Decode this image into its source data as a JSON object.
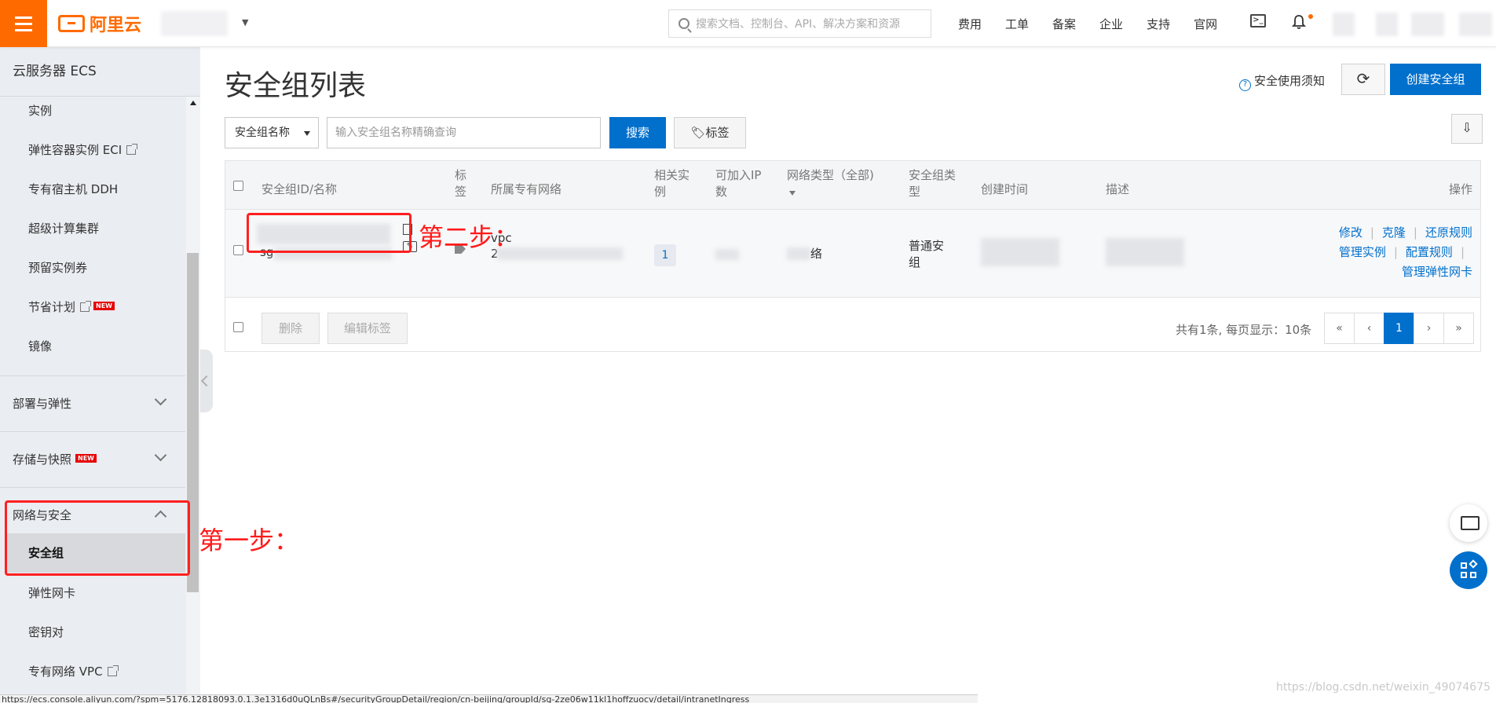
{
  "header": {
    "brand": "阿里云",
    "search_placeholder": "搜索文档、控制台、API、解决方案和资源",
    "nav": [
      "费用",
      "工单",
      "备案",
      "企业",
      "支持",
      "官网"
    ]
  },
  "sidebar": {
    "title": "云服务器 ECS",
    "items_top": [
      {
        "label": "实例"
      },
      {
        "label": "弹性容器实例 ECI",
        "external": true
      },
      {
        "label": "专有宿主机 DDH"
      },
      {
        "label": "超级计算集群"
      },
      {
        "label": "预留实例券"
      },
      {
        "label": "节省计划",
        "external": true,
        "badge": "NEW"
      },
      {
        "label": "镜像"
      }
    ],
    "groups": [
      {
        "label": "部署与弹性"
      },
      {
        "label": "存储与快照",
        "badge": "NEW"
      },
      {
        "label": "网络与安全",
        "expanded": true
      }
    ],
    "network_items": [
      {
        "label": "安全组",
        "active": true
      },
      {
        "label": "弹性网卡"
      },
      {
        "label": "密钥对"
      },
      {
        "label": "专有网络 VPC",
        "external": true
      }
    ]
  },
  "main": {
    "title": "安全组列表",
    "help_link": "安全使用须知",
    "refresh_glyph": "⟳",
    "create_button": "创建安全组",
    "filter_select": "安全组名称",
    "filter_placeholder": "输入安全组名称精确查询",
    "search_button": "搜索",
    "tag_button": "标签",
    "table": {
      "headers": {
        "id_name": "安全组ID/名称",
        "tag_l1": "标",
        "tag_l2": "签",
        "vpc": "所属专有网络",
        "instances_l1": "相关实",
        "instances_l2": "例",
        "ip_l1": "可加入IP",
        "ip_l2": "数",
        "net_type": "网络类型（全部)",
        "sg_type_l1": "安全组类",
        "sg_type_l2": "型",
        "created": "创建时间",
        "desc": "描述",
        "actions": "操作"
      },
      "row": {
        "id_prefix": "sg",
        "vpc_partial_1": "vpc",
        "vpc_partial_2": "2",
        "instances": "1",
        "net_type_suffix": "络",
        "sg_type_l1": "普通安",
        "sg_type_l2": "组",
        "actions": [
          "修改",
          "克隆",
          "还原规则",
          "管理实例",
          "配置规则",
          "管理弹性网卡"
        ]
      }
    },
    "footer": {
      "delete_button": "删除",
      "edit_tags_button": "编辑标签",
      "page_info": "共有1条, 每页显示：10条",
      "pager": [
        "«",
        "‹",
        "1",
        "›",
        "»"
      ],
      "current_page": "1"
    }
  },
  "annotations": {
    "step1": "第一步：",
    "step2": "第二步："
  },
  "status_url": "https://ecs.console.aliyun.com/?spm=5176.12818093.0.1.3e1316d0uQLnBs#/securityGroupDetail/region/cn-beijing/groupId/sg-2ze06w11kl1hoffzuocv/detail/intranetIngress",
  "watermark": "https://blog.csdn.net/weixin_49074675",
  "colors": {
    "brand": "#ff6a00",
    "primary": "#0070cc",
    "annotation": "#ff1a1a"
  }
}
